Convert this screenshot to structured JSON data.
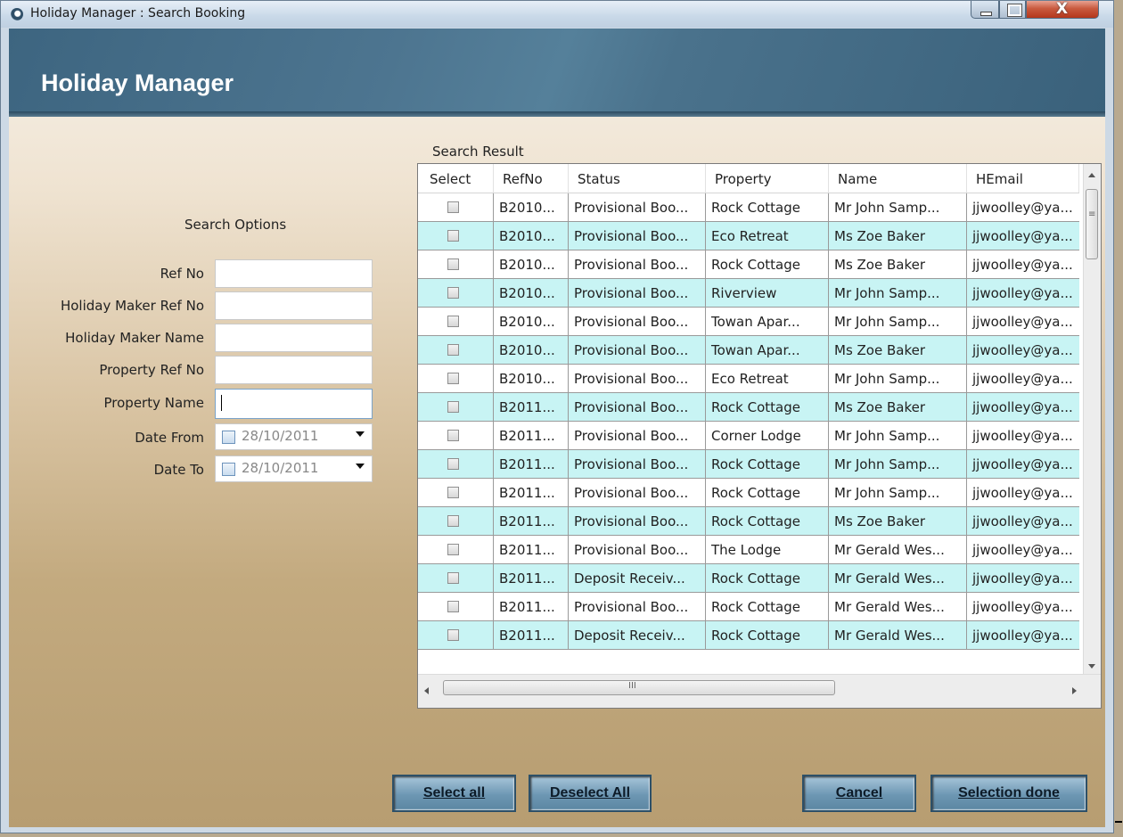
{
  "window": {
    "title": "Holiday Manager : Search Booking",
    "close_glyph": "X"
  },
  "header": {
    "title": "Holiday Manager"
  },
  "search_options": {
    "label": "Search Options",
    "fields": [
      {
        "label": "Ref No",
        "value": ""
      },
      {
        "label": "Holiday Maker Ref No",
        "value": ""
      },
      {
        "label": "Holiday Maker Name",
        "value": ""
      },
      {
        "label": "Property Ref No",
        "value": ""
      },
      {
        "label": "Property Name",
        "value": ""
      }
    ],
    "date_from": {
      "label": "Date From",
      "value": "28/10/2011"
    },
    "date_to": {
      "label": "Date To",
      "value": "28/10/2011"
    }
  },
  "results": {
    "label": "Search Result",
    "columns": [
      "Select",
      "RefNo",
      "Status",
      "Property",
      "Name",
      "HEmail"
    ],
    "rows": [
      [
        "B2010...",
        "Provisional Boo...",
        "Rock Cottage",
        "Mr John Samp...",
        "jjwoolley@ya..."
      ],
      [
        "B2010...",
        "Provisional Boo...",
        "Eco Retreat",
        "Ms Zoe Baker",
        "jjwoolley@ya..."
      ],
      [
        "B2010...",
        "Provisional Boo...",
        "Rock Cottage",
        "Ms Zoe Baker",
        "jjwoolley@ya..."
      ],
      [
        "B2010...",
        "Provisional Boo...",
        "Riverview",
        "Mr John Samp...",
        "jjwoolley@ya..."
      ],
      [
        "B2010...",
        "Provisional Boo...",
        "Towan Apar...",
        "Mr John Samp...",
        "jjwoolley@ya..."
      ],
      [
        "B2010...",
        "Provisional Boo...",
        "Towan Apar...",
        "Ms Zoe Baker",
        "jjwoolley@ya..."
      ],
      [
        "B2010...",
        "Provisional Boo...",
        "Eco Retreat",
        "Mr John Samp...",
        "jjwoolley@ya..."
      ],
      [
        "B2011...",
        "Provisional Boo...",
        "Rock Cottage",
        "Ms Zoe Baker",
        "jjwoolley@ya..."
      ],
      [
        "B2011...",
        "Provisional Boo...",
        "Corner Lodge",
        "Mr John Samp...",
        "jjwoolley@ya..."
      ],
      [
        "B2011...",
        "Provisional Boo...",
        "Rock Cottage",
        "Mr John Samp...",
        "jjwoolley@ya..."
      ],
      [
        "B2011...",
        "Provisional Boo...",
        "Rock Cottage",
        "Mr John Samp...",
        "jjwoolley@ya..."
      ],
      [
        "B2011...",
        "Provisional Boo...",
        "Rock Cottage",
        "Ms Zoe Baker",
        "jjwoolley@ya..."
      ],
      [
        "B2011...",
        "Provisional Boo...",
        "The Lodge",
        "Mr Gerald Wes...",
        "jjwoolley@ya..."
      ],
      [
        "B2011...",
        "Deposit Receiv...",
        "Rock Cottage",
        "Mr Gerald Wes...",
        "jjwoolley@ya..."
      ],
      [
        "B2011...",
        "Provisional Boo...",
        "Rock Cottage",
        "Mr Gerald Wes...",
        "jjwoolley@ya..."
      ],
      [
        "B2011...",
        "Deposit Receiv...",
        "Rock Cottage",
        "Mr Gerald Wes...",
        "jjwoolley@ya..."
      ]
    ],
    "hscroll_grip": "III",
    "vscroll_grip": "≡"
  },
  "buttons": {
    "select_all": "Select all",
    "deselect_all": "Deselect All",
    "cancel": "Cancel",
    "selection_done": "Selection done"
  },
  "colors": {
    "header": "#4a728c",
    "row_alt": "#c8f4f4",
    "button": "#6d97b3"
  }
}
